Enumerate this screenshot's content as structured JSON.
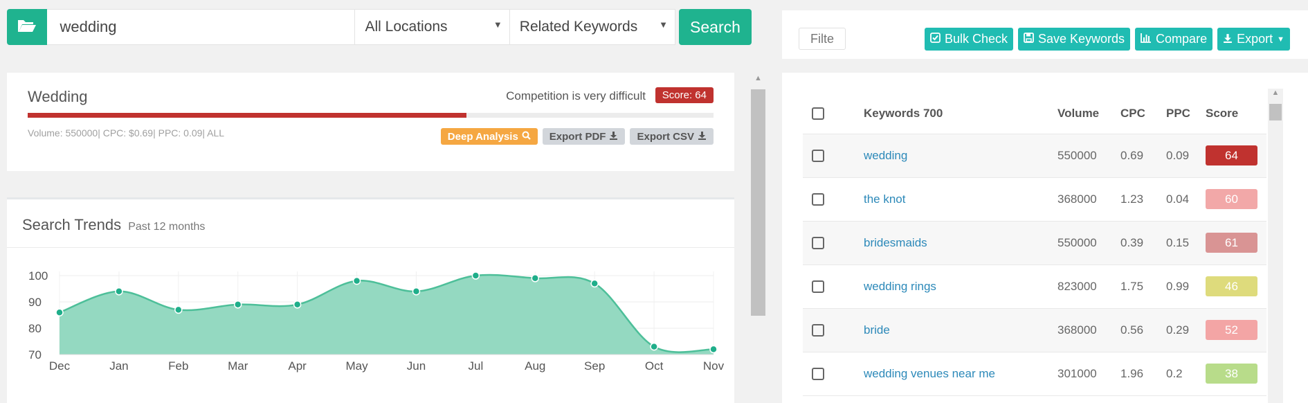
{
  "search": {
    "keyword_value": "wedding",
    "location_selected": "All Locations",
    "mode_selected": "Related Keywords",
    "search_label": "Search"
  },
  "summary": {
    "title": "Wedding",
    "competition_text": "Competition is very difficult",
    "score_label": "Score: 64",
    "score_value": 64,
    "score_color": "#c0322f",
    "meta": "Volume: 550000| CPC: $0.69| PPC: 0.09| ALL",
    "deep_analysis_label": "Deep Analysis",
    "export_pdf_label": "Export PDF",
    "export_csv_label": "Export CSV"
  },
  "trends": {
    "title": "Search Trends",
    "subtitle": "Past 12 months"
  },
  "chart_data": {
    "type": "area",
    "categories": [
      "Dec",
      "Jan",
      "Feb",
      "Mar",
      "Apr",
      "May",
      "Jun",
      "Jul",
      "Aug",
      "Sep",
      "Oct",
      "Nov"
    ],
    "values": [
      86,
      94,
      87,
      89,
      89,
      98,
      94,
      100,
      99,
      97,
      73,
      72
    ],
    "yticks": [
      70,
      80,
      90,
      100
    ],
    "ylim": [
      70,
      100
    ],
    "grid": true,
    "fill_color": "#94d9c1",
    "line_color": "#4dbf99",
    "point_color": "#1fae8a"
  },
  "toolbar": {
    "filter_placeholder": "Filter",
    "bulk_check_label": "Bulk Check",
    "save_keywords_label": "Save Keywords",
    "compare_label": "Compare",
    "export_label": "Export"
  },
  "table": {
    "headers": {
      "keywords": "Keywords 700",
      "volume": "Volume",
      "cpc": "CPC",
      "ppc": "PPC",
      "score": "Score"
    },
    "rows": [
      {
        "keyword": "wedding",
        "volume": "550000",
        "cpc": "0.69",
        "ppc": "0.09",
        "score": "64",
        "score_color": "#c0322f"
      },
      {
        "keyword": "the knot",
        "volume": "368000",
        "cpc": "1.23",
        "ppc": "0.04",
        "score": "60",
        "score_color": "#f2a8a8"
      },
      {
        "keyword": "bridesmaids",
        "volume": "550000",
        "cpc": "0.39",
        "ppc": "0.15",
        "score": "61",
        "score_color": "#d99494"
      },
      {
        "keyword": "wedding rings",
        "volume": "823000",
        "cpc": "1.75",
        "ppc": "0.99",
        "score": "46",
        "score_color": "#dedb7c"
      },
      {
        "keyword": "bride",
        "volume": "368000",
        "cpc": "0.56",
        "ppc": "0.29",
        "score": "52",
        "score_color": "#f3a5a5"
      },
      {
        "keyword": "wedding venues near me",
        "volume": "301000",
        "cpc": "1.96",
        "ppc": "0.2",
        "score": "38",
        "score_color": "#b8dc8a"
      }
    ]
  }
}
